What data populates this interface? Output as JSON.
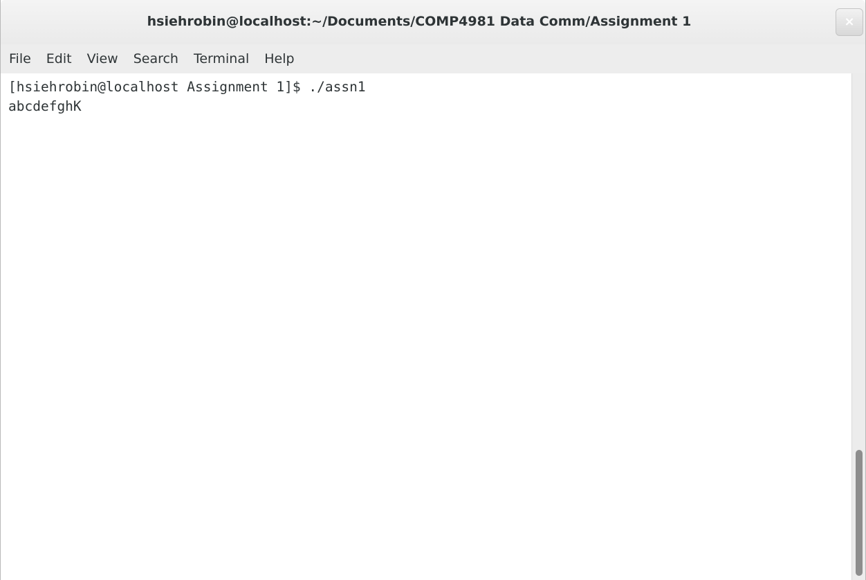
{
  "window": {
    "title": "hsiehrobin@localhost:~/Documents/COMP4981 Data Comm/Assignment 1",
    "close_symbol": "×"
  },
  "menu": {
    "items": [
      {
        "label": "File"
      },
      {
        "label": "Edit"
      },
      {
        "label": "View"
      },
      {
        "label": "Search"
      },
      {
        "label": "Terminal"
      },
      {
        "label": "Help"
      }
    ]
  },
  "terminal": {
    "lines": [
      "[hsiehrobin@localhost Assignment 1]$ ./assn1",
      "abcdefghK"
    ]
  },
  "icons": {
    "close": "close-icon"
  },
  "colors": {
    "text": "#2e3436",
    "background": "#ffffff",
    "menubar": "#ededed"
  }
}
